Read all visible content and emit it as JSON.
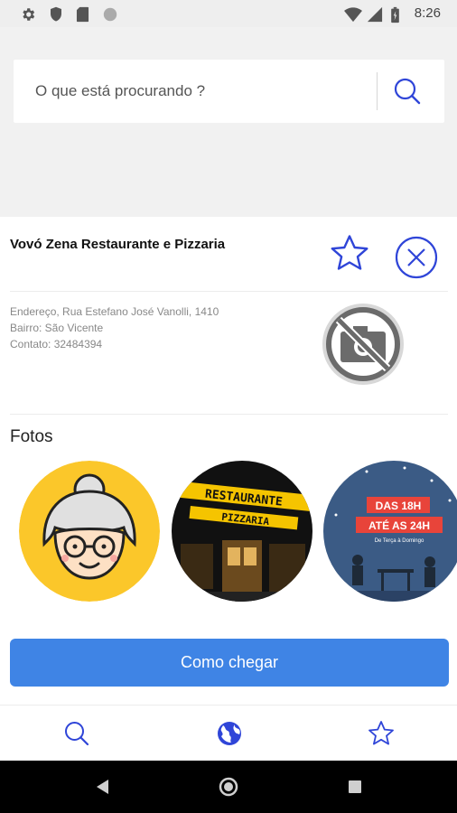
{
  "status_bar": {
    "time": "8:26",
    "icons": [
      "gear-icon",
      "shield-icon",
      "sd-card-icon",
      "circle-icon",
      "wifi-icon",
      "signal-icon",
      "battery-icon"
    ]
  },
  "search": {
    "placeholder": "O que está procurando ?",
    "value": ""
  },
  "place": {
    "name": "Vovó Zena Restaurante e Pizzaria",
    "address": "Endereço, Rua Estefano José Vanolli, 1410",
    "neighborhood": "Bairro: São Vicente",
    "contact": "Contato:  32484394"
  },
  "photos": {
    "title": "Fotos",
    "items": [
      {
        "name": "grandma-logo-photo"
      },
      {
        "name": "restaurant-facade-photo",
        "sign_text": "RESTAURANTE PIZZARIA"
      },
      {
        "name": "promo-banner-photo",
        "line1": "DAS 18H",
        "line2": "ATÉ AS 24H",
        "line3": "De Terça à Domingo"
      }
    ]
  },
  "actions": {
    "directions_label": "Como chegar"
  },
  "bottom_nav": {
    "items": [
      "search-icon",
      "globe-icon",
      "star-icon"
    ]
  },
  "colors": {
    "accent": "#2f45d8",
    "button": "#3f84e5",
    "yellow": "#fbc72a"
  }
}
